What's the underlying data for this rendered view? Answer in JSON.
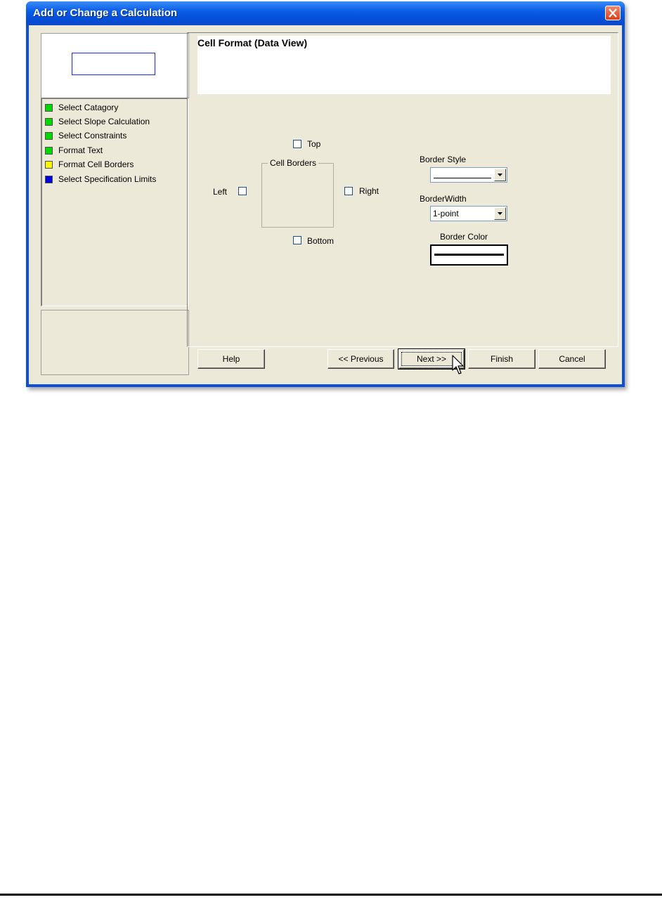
{
  "window": {
    "title": "Add or Change a Calculation"
  },
  "steps": [
    {
      "label": "Select Catagory",
      "color": "#00d800"
    },
    {
      "label": "Select Slope Calculation",
      "color": "#00d800"
    },
    {
      "label": "Select Constraints",
      "color": "#00d800"
    },
    {
      "label": "Format Text",
      "color": "#00d800"
    },
    {
      "label": "Format Cell Borders",
      "color": "#f8f800"
    },
    {
      "label": "Select Specification Limits",
      "color": "#0000e0"
    }
  ],
  "page": {
    "heading": "Cell Format (Data View)",
    "cell_borders": {
      "group_label": "Cell Borders",
      "top_label": "Top",
      "left_label": "Left",
      "right_label": "Right",
      "bottom_label": "Bottom"
    },
    "border_style": {
      "label": "Border Style"
    },
    "border_width": {
      "label": "BorderWidth",
      "value": "1-point"
    },
    "border_color": {
      "label": "Border Color"
    }
  },
  "buttons": {
    "help": "Help",
    "previous": "<< Previous",
    "next": "Next >>",
    "finish": "Finish",
    "cancel": "Cancel"
  }
}
